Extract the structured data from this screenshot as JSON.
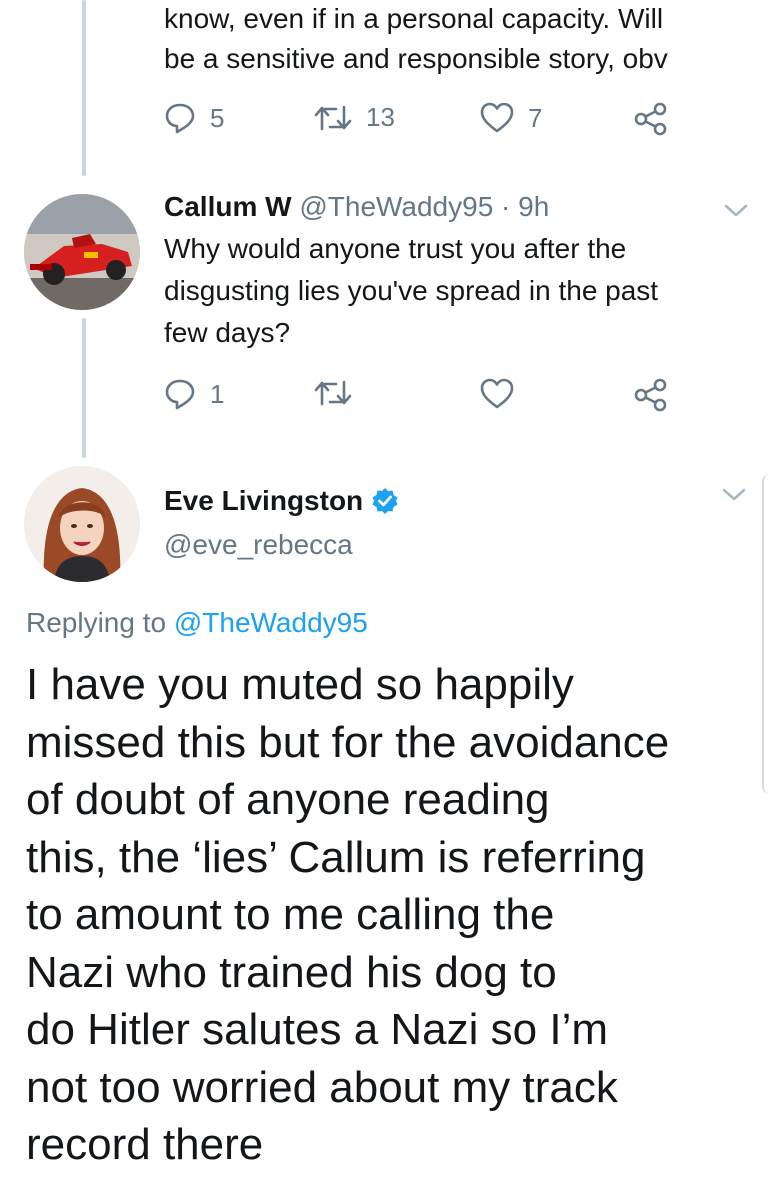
{
  "tweet1": {
    "text_lines": [
      "know, even if in a personal capacity. Will",
      "be a sensitive and responsible story, obv"
    ],
    "replies": "5",
    "retweets": "13",
    "likes": "7"
  },
  "tweet2": {
    "name": "Callum W",
    "handle": "@TheWaddy95",
    "separator": " · ",
    "time": "9h",
    "text_lines": [
      "Why would anyone trust you after the",
      "disgusting lies you've spread in the past",
      "few days?"
    ],
    "replies": "1"
  },
  "main_tweet": {
    "name": "Eve Livingston",
    "handle": "@eve_rebecca",
    "verified": true,
    "replying_prefix": "Replying to ",
    "replying_to": "@TheWaddy95",
    "text_lines": [
      "I have you muted so happily",
      "missed this but for the avoidance",
      "of doubt of anyone reading",
      "this, the ‘lies’ Callum is referring",
      "to amount to me calling the",
      "Nazi who trained his dog to",
      "do Hitler salutes a Nazi so I’m",
      "not too worried about my track",
      "record there"
    ]
  },
  "colors": {
    "accent": "#1da1f2",
    "muted": "#657786",
    "text": "#14171a",
    "line": "#ccd6dd"
  },
  "icons": [
    "reply-icon",
    "retweet-icon",
    "like-icon",
    "share-icon",
    "chevron-down-icon",
    "verified-badge-icon"
  ]
}
